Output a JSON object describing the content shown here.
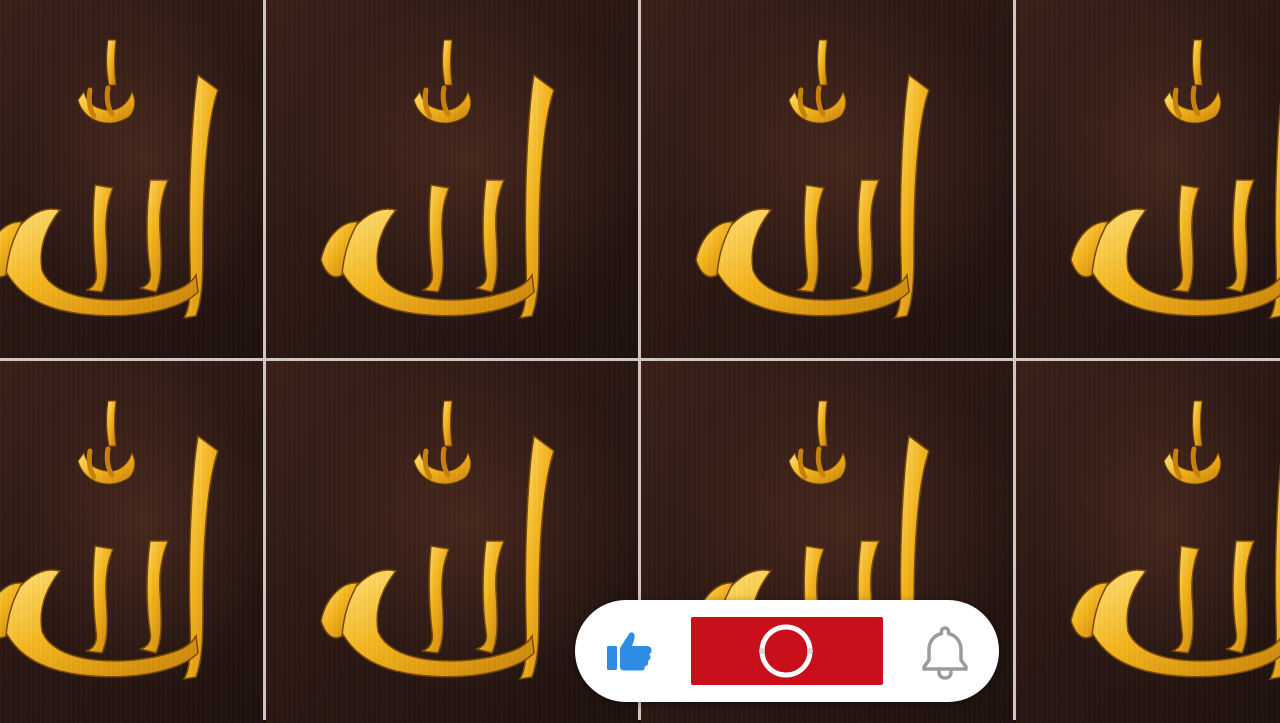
{
  "video": {
    "tile_count": 8,
    "tile_background": "#2a1712",
    "calligraphy_color": "#f2b51c"
  },
  "overlay": {
    "like_icon": "thumbs-up-icon",
    "like_color": "#2f8ce4",
    "subscribe_color": "#c90f1a",
    "subscribe_icon": "ring-icon",
    "bell_icon": "bell-icon",
    "bell_color": "#9b9b9b"
  }
}
